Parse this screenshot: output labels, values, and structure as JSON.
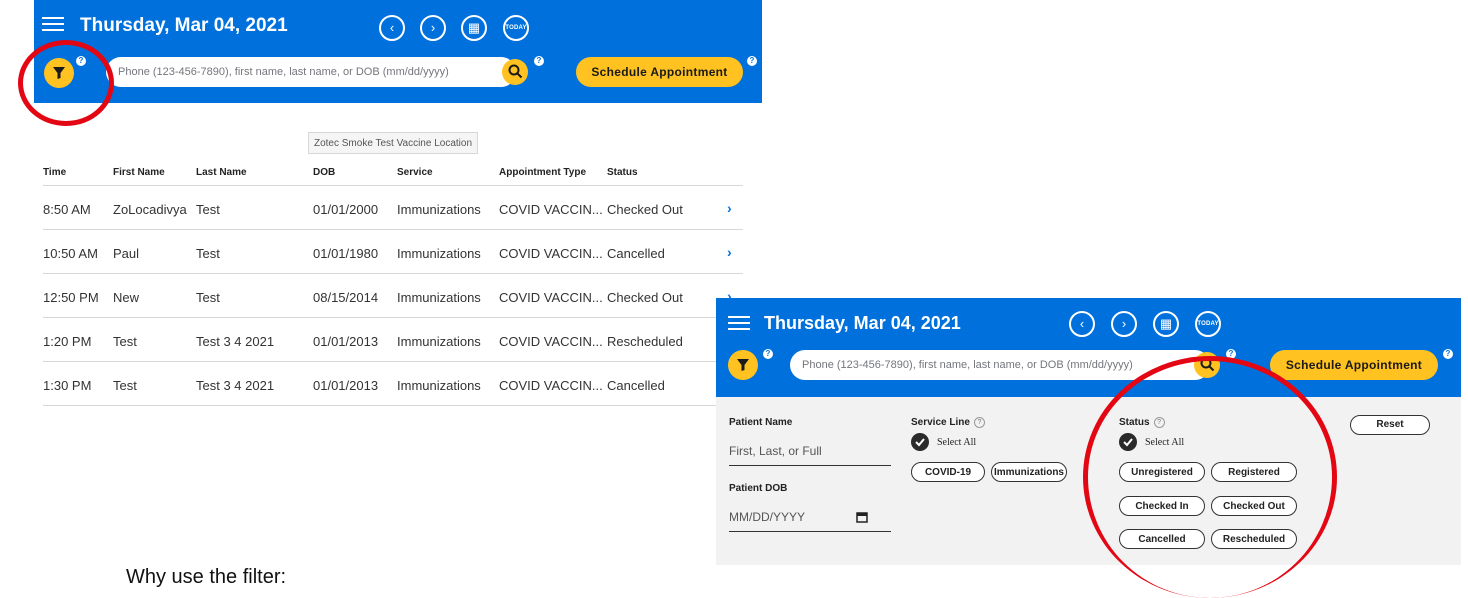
{
  "top_panel": {
    "date": "Thursday, Mar 04, 2021",
    "nav": {
      "prev": "‹",
      "next": "›",
      "calendar": "▦",
      "today": "TODAY"
    },
    "search_placeholder": "Phone (123-456-7890), first name, last name, or DOB (mm/dd/yyyy)",
    "help": "?",
    "schedule_label": "Schedule Appointment"
  },
  "location_label": "Zotec Smoke Test Vaccine Location",
  "table": {
    "headers": [
      "Time",
      "First Name",
      "Last Name",
      "DOB",
      "Service",
      "Appointment Type",
      "Status"
    ],
    "rows": [
      [
        "8:50 AM",
        "ZoLocadivya",
        "Test",
        "01/01/2000",
        "Immunizations",
        "COVID VACCIN...",
        "Checked Out"
      ],
      [
        "10:50 AM",
        "Paul",
        "Test",
        "01/01/1980",
        "Immunizations",
        "COVID VACCIN...",
        "Cancelled"
      ],
      [
        "12:50 PM",
        "New",
        "Test",
        "08/15/2014",
        "Immunizations",
        "COVID VACCIN...",
        "Checked Out"
      ],
      [
        "1:20 PM",
        "Test",
        "Test 3 4 2021",
        "01/01/2013",
        "Immunizations",
        "COVID VACCIN...",
        "Rescheduled"
      ],
      [
        "1:30 PM",
        "Test",
        "Test 3 4 2021",
        "01/01/2013",
        "Immunizations",
        "COVID VACCIN...",
        "Cancelled"
      ]
    ],
    "row_chevron": "›"
  },
  "filter_panel": {
    "date": "Thursday, Mar 04, 2021",
    "search_placeholder": "Phone (123-456-7890), first name, last name, or DOB (mm/dd/yyyy)",
    "schedule_label": "Schedule Appointment",
    "patient_name_label": "Patient Name",
    "patient_name_placeholder": "First, Last, or Full",
    "patient_dob_label": "Patient DOB",
    "patient_dob_placeholder": "MM/DD/YYYY",
    "service_line_label": "Service Line",
    "status_label": "Status",
    "select_all": "Select All",
    "service_options": [
      "COVID-19",
      "Immunizations"
    ],
    "status_options": [
      "Unregistered",
      "Registered",
      "Checked In",
      "Checked Out",
      "Cancelled",
      "Rescheduled"
    ],
    "reset_label": "Reset"
  },
  "caption": "Why use the filter:",
  "colors": {
    "header_blue": "#0071dc",
    "accent_yellow": "#ffc220",
    "highlight_red": "#e30613"
  }
}
